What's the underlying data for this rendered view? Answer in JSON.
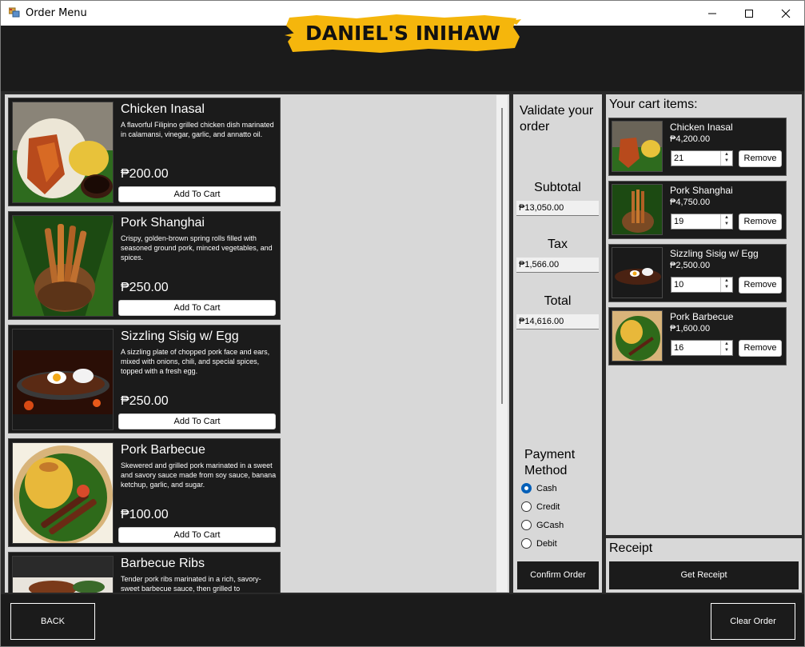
{
  "window": {
    "title": "Order Menu"
  },
  "header": {
    "logo_text": "DANIEL'S INIHAW",
    "logo_color": "#f5b60c"
  },
  "menu": {
    "add_label": "Add To Cart",
    "items": [
      {
        "name": "Chicken Inasal",
        "description": "A flavorful Filipino grilled chicken dish marinated in calamansi, vinegar, garlic, and annatto oil.",
        "price": "₱200.00",
        "image": "chicken-inasal-image"
      },
      {
        "name": "Pork Shanghai",
        "description": "Crispy, golden-brown spring rolls filled with seasoned ground pork, minced vegetables, and spices.",
        "price": "₱250.00",
        "image": "pork-shanghai-image"
      },
      {
        "name": "Sizzling Sisig w/ Egg",
        "description": "A sizzling plate of chopped pork face and ears, mixed with onions, chili, and special spices, topped with a fresh egg.",
        "price": "₱250.00",
        "image": "sizzling-sisig-image"
      },
      {
        "name": "Pork Barbecue",
        "description": "Skewered and grilled pork marinated in a sweet and savory sauce made from soy sauce, banana ketchup, garlic, and sugar.",
        "price": "₱100.00",
        "image": "pork-barbecue-image"
      },
      {
        "name": "Barbecue Ribs",
        "description": "Tender pork ribs marinated in a rich, savory-sweet barbecue sauce, then grilled to",
        "price": "",
        "image": "barbecue-ribs-image"
      }
    ]
  },
  "validate": {
    "title": "Validate your order",
    "subtotal_label": "Subtotal",
    "subtotal_value": "₱13,050.00",
    "tax_label": "Tax",
    "tax_value": "₱1,566.00",
    "total_label": "Total",
    "total_value": "₱14,616.00",
    "payment_title": "Payment Method",
    "payment_options": [
      "Cash",
      "Credit",
      "GCash",
      "Debit"
    ],
    "payment_selected": "Cash",
    "confirm_label": "Confirm Order"
  },
  "cart": {
    "title": "Your cart items:",
    "remove_label": "Remove",
    "items": [
      {
        "name": "Chicken Inasal",
        "price": "₱4,200.00",
        "qty": "21"
      },
      {
        "name": "Pork Shanghai",
        "price": "₱4,750.00",
        "qty": "19"
      },
      {
        "name": "Sizzling Sisig w/ Egg",
        "price": "₱2,500.00",
        "qty": "10"
      },
      {
        "name": "Pork Barbecue",
        "price": "₱1,600.00",
        "qty": "16"
      }
    ]
  },
  "receipt": {
    "title": "Receipt",
    "button_label": "Get Receipt"
  },
  "footer": {
    "back_label": "BACK",
    "clear_label": "Clear Order"
  }
}
